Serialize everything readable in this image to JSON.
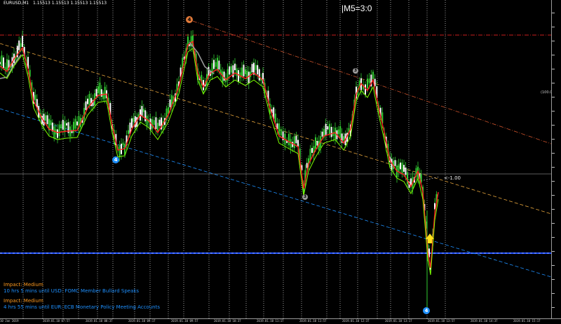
{
  "header": {
    "symbol": "EURUSD,M1",
    "ohlc": [
      "1.15513",
      "1.15513",
      "1.15513",
      "1.15513"
    ]
  },
  "mode_label": "|M5=3:0",
  "fib_label": "(100.0%)",
  "level_label": "<-1.00",
  "wave_markers": {
    "top": "4",
    "left": "4",
    "mid_top": "3",
    "mid_bottom": "3",
    "bottom": "4"
  },
  "news": [
    {
      "impact": "Impact: Medium",
      "text": "10 hrs 5 mins until USD: FOMC Member Bullard Speaks"
    },
    {
      "impact": "Impact: Medium",
      "text": "4 hrs 55 mins until EUR: ECB Monetary Policy Meeting Accounts"
    }
  ],
  "time_labels": [
    "10 Jan 2019",
    "2019.01.10 07:57",
    "2019.01.10 08:37",
    "2019.01.10 09:17",
    "2019.01.10 09:57",
    "2019.01.10 10:37",
    "2019.01.10 11:17",
    "2019.01.10 11:57",
    "2019.01.10 12:37",
    "2019.01.10 13:17",
    "2019.01.10 13:57",
    "2019.01.10 14:37",
    "2019.01.10 15:17"
  ],
  "colors": {
    "background": "#000000",
    "candle_up": "#32cd32",
    "ma_red": "#ff2020",
    "ma_gray": "#9a9a9a",
    "red_dashdot": "#c81e1e",
    "orange_channel": "#e07a3a",
    "yellow_channel": "#e6a53c",
    "blue_channel": "#1e90ff",
    "horizontal_blue": "#2050ff",
    "news_impact": "#ff9a1f",
    "news_text": "#1e90ff"
  },
  "icons": {
    "up_arrow": "yellow-up-arrow-icon"
  }
}
